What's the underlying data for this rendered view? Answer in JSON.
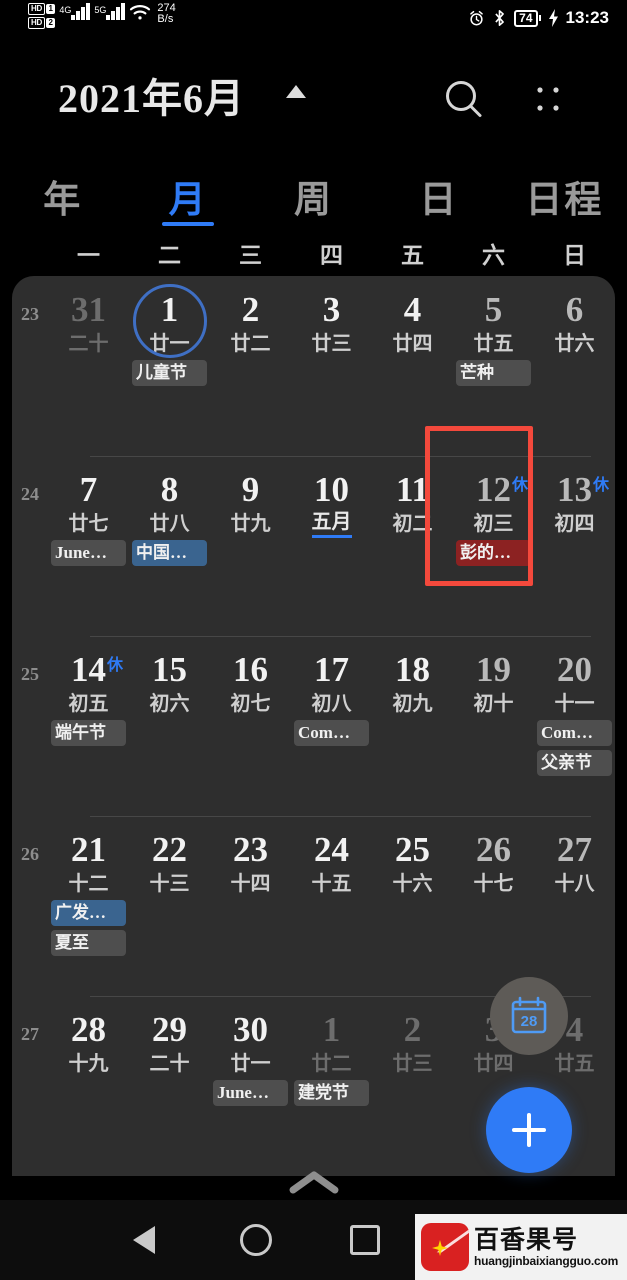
{
  "statusbar": {
    "carrier_hd1_label": "HD",
    "carrier_hd1_num": "1",
    "carrier_hd2_label": "HD",
    "carrier_hd2_num": "2",
    "net_gen_1": "4G",
    "net_gen_2": "5G",
    "speed_value": "274",
    "speed_unit": "B/s",
    "battery": "74",
    "time": "13:23",
    "icons": [
      "alarm-icon",
      "bluetooth-icon",
      "battery-icon",
      "charging-icon"
    ]
  },
  "header": {
    "title": "2021年6月",
    "caret": "caret-up-icon",
    "search": "search-icon",
    "menu": "grid-menu-icon"
  },
  "tabs": [
    {
      "label": "年",
      "active": false
    },
    {
      "label": "月",
      "active": true
    },
    {
      "label": "周",
      "active": false
    },
    {
      "label": "日",
      "active": false
    },
    {
      "label": "日程",
      "active": false
    }
  ],
  "weekdays": [
    "一",
    "二",
    "三",
    "四",
    "五",
    "六",
    "日"
  ],
  "weeks": [
    {
      "weeknum": "23",
      "days": [
        {
          "num": "31",
          "lunar": "二十",
          "other": true,
          "weekend": false,
          "rest": "",
          "selected": false,
          "lunar_month": false,
          "events": []
        },
        {
          "num": "1",
          "lunar": "廿一",
          "other": false,
          "weekend": false,
          "rest": "",
          "selected": true,
          "lunar_month": false,
          "events": [
            {
              "text": "儿童节",
              "color": "grey"
            }
          ]
        },
        {
          "num": "2",
          "lunar": "廿二",
          "other": false,
          "weekend": false,
          "rest": "",
          "selected": false,
          "lunar_month": false,
          "events": []
        },
        {
          "num": "3",
          "lunar": "廿三",
          "other": false,
          "weekend": false,
          "rest": "",
          "selected": false,
          "lunar_month": false,
          "events": []
        },
        {
          "num": "4",
          "lunar": "廿四",
          "other": false,
          "weekend": false,
          "rest": "",
          "selected": false,
          "lunar_month": false,
          "events": []
        },
        {
          "num": "5",
          "lunar": "廿五",
          "other": false,
          "weekend": true,
          "rest": "",
          "selected": false,
          "lunar_month": false,
          "events": [
            {
              "text": "芒种",
              "color": "grey"
            }
          ]
        },
        {
          "num": "6",
          "lunar": "廿六",
          "other": false,
          "weekend": true,
          "rest": "",
          "selected": false,
          "lunar_month": false,
          "events": []
        }
      ]
    },
    {
      "weeknum": "24",
      "days": [
        {
          "num": "7",
          "lunar": "廿七",
          "other": false,
          "weekend": false,
          "rest": "",
          "selected": false,
          "lunar_month": false,
          "events": [
            {
              "text": "June…",
              "color": "grey"
            }
          ]
        },
        {
          "num": "8",
          "lunar": "廿八",
          "other": false,
          "weekend": false,
          "rest": "",
          "selected": false,
          "lunar_month": false,
          "events": [
            {
              "text": "中国…",
              "color": "blue"
            }
          ]
        },
        {
          "num": "9",
          "lunar": "廿九",
          "other": false,
          "weekend": false,
          "rest": "",
          "selected": false,
          "lunar_month": false,
          "events": []
        },
        {
          "num": "10",
          "lunar": "五月",
          "other": false,
          "weekend": false,
          "rest": "",
          "selected": false,
          "lunar_month": true,
          "events": []
        },
        {
          "num": "11",
          "lunar": "初二",
          "other": false,
          "weekend": false,
          "rest": "",
          "selected": false,
          "lunar_month": false,
          "events": []
        },
        {
          "num": "12",
          "lunar": "初三",
          "other": false,
          "weekend": true,
          "rest": "休",
          "selected": false,
          "lunar_month": false,
          "events": [
            {
              "text": "彭的…",
              "color": "red"
            }
          ]
        },
        {
          "num": "13",
          "lunar": "初四",
          "other": false,
          "weekend": true,
          "rest": "休",
          "selected": false,
          "lunar_month": false,
          "events": []
        }
      ]
    },
    {
      "weeknum": "25",
      "days": [
        {
          "num": "14",
          "lunar": "初五",
          "other": false,
          "weekend": false,
          "rest": "休",
          "selected": false,
          "lunar_month": false,
          "events": [
            {
              "text": "端午节",
              "color": "grey"
            }
          ]
        },
        {
          "num": "15",
          "lunar": "初六",
          "other": false,
          "weekend": false,
          "rest": "",
          "selected": false,
          "lunar_month": false,
          "events": []
        },
        {
          "num": "16",
          "lunar": "初七",
          "other": false,
          "weekend": false,
          "rest": "",
          "selected": false,
          "lunar_month": false,
          "events": []
        },
        {
          "num": "17",
          "lunar": "初八",
          "other": false,
          "weekend": false,
          "rest": "",
          "selected": false,
          "lunar_month": false,
          "events": [
            {
              "text": "Com…",
              "color": "grey"
            }
          ]
        },
        {
          "num": "18",
          "lunar": "初九",
          "other": false,
          "weekend": false,
          "rest": "",
          "selected": false,
          "lunar_month": false,
          "events": []
        },
        {
          "num": "19",
          "lunar": "初十",
          "other": false,
          "weekend": true,
          "rest": "",
          "selected": false,
          "lunar_month": false,
          "events": []
        },
        {
          "num": "20",
          "lunar": "十一",
          "other": false,
          "weekend": true,
          "rest": "",
          "selected": false,
          "lunar_month": false,
          "events": [
            {
              "text": "Com…",
              "color": "grey"
            },
            {
              "text": "父亲节",
              "color": "grey"
            }
          ]
        }
      ]
    },
    {
      "weeknum": "26",
      "days": [
        {
          "num": "21",
          "lunar": "十二",
          "other": false,
          "weekend": false,
          "rest": "",
          "selected": false,
          "lunar_month": false,
          "events": [
            {
              "text": "广发…",
              "color": "blue"
            },
            {
              "text": "夏至",
              "color": "grey"
            }
          ]
        },
        {
          "num": "22",
          "lunar": "十三",
          "other": false,
          "weekend": false,
          "rest": "",
          "selected": false,
          "lunar_month": false,
          "events": []
        },
        {
          "num": "23",
          "lunar": "十四",
          "other": false,
          "weekend": false,
          "rest": "",
          "selected": false,
          "lunar_month": false,
          "events": []
        },
        {
          "num": "24",
          "lunar": "十五",
          "other": false,
          "weekend": false,
          "rest": "",
          "selected": false,
          "lunar_month": false,
          "events": []
        },
        {
          "num": "25",
          "lunar": "十六",
          "other": false,
          "weekend": false,
          "rest": "",
          "selected": false,
          "lunar_month": false,
          "events": []
        },
        {
          "num": "26",
          "lunar": "十七",
          "other": false,
          "weekend": true,
          "rest": "",
          "selected": false,
          "lunar_month": false,
          "events": []
        },
        {
          "num": "27",
          "lunar": "十八",
          "other": false,
          "weekend": true,
          "rest": "",
          "selected": false,
          "lunar_month": false,
          "events": []
        }
      ]
    },
    {
      "weeknum": "27",
      "days": [
        {
          "num": "28",
          "lunar": "十九",
          "other": false,
          "weekend": false,
          "rest": "",
          "selected": false,
          "lunar_month": false,
          "events": []
        },
        {
          "num": "29",
          "lunar": "二十",
          "other": false,
          "weekend": false,
          "rest": "",
          "selected": false,
          "lunar_month": false,
          "events": []
        },
        {
          "num": "30",
          "lunar": "廿一",
          "other": false,
          "weekend": false,
          "rest": "",
          "selected": false,
          "lunar_month": false,
          "events": [
            {
              "text": "June…",
              "color": "grey"
            }
          ]
        },
        {
          "num": "1",
          "lunar": "廿二",
          "other": true,
          "weekend": false,
          "rest": "",
          "selected": false,
          "lunar_month": false,
          "events": [
            {
              "text": "建党节",
              "color": "grey"
            }
          ]
        },
        {
          "num": "2",
          "lunar": "廿三",
          "other": true,
          "weekend": false,
          "rest": "",
          "selected": false,
          "lunar_month": false,
          "events": []
        },
        {
          "num": "3",
          "lunar": "廿四",
          "other": true,
          "weekend": false,
          "rest": "",
          "selected": false,
          "lunar_month": false,
          "events": []
        },
        {
          "num": "4",
          "lunar": "廿五",
          "other": true,
          "weekend": true,
          "rest": "",
          "selected": false,
          "lunar_month": false,
          "events": []
        }
      ]
    }
  ],
  "fab": {
    "today_label": "28",
    "today_icon": "calendar-today-icon",
    "add_icon": "plus-icon"
  },
  "annotation": {
    "type": "red-highlight-box",
    "target": "12"
  },
  "collapse_handle": "chevron-up-icon",
  "navbar": {
    "back": "back-triangle-icon",
    "home": "home-circle-icon",
    "recents": "recents-square-icon"
  },
  "watermark": {
    "name": "百香果号",
    "url": "huangjinbaixiangguo.com"
  },
  "colors": {
    "accent": "#2f7bf6",
    "panel": "#2e2e2e",
    "background": "#000000",
    "annotation": "#f4493c",
    "chip_grey": "#4e4e4e",
    "chip_blue": "#3a648f",
    "chip_red": "#8c2222"
  }
}
